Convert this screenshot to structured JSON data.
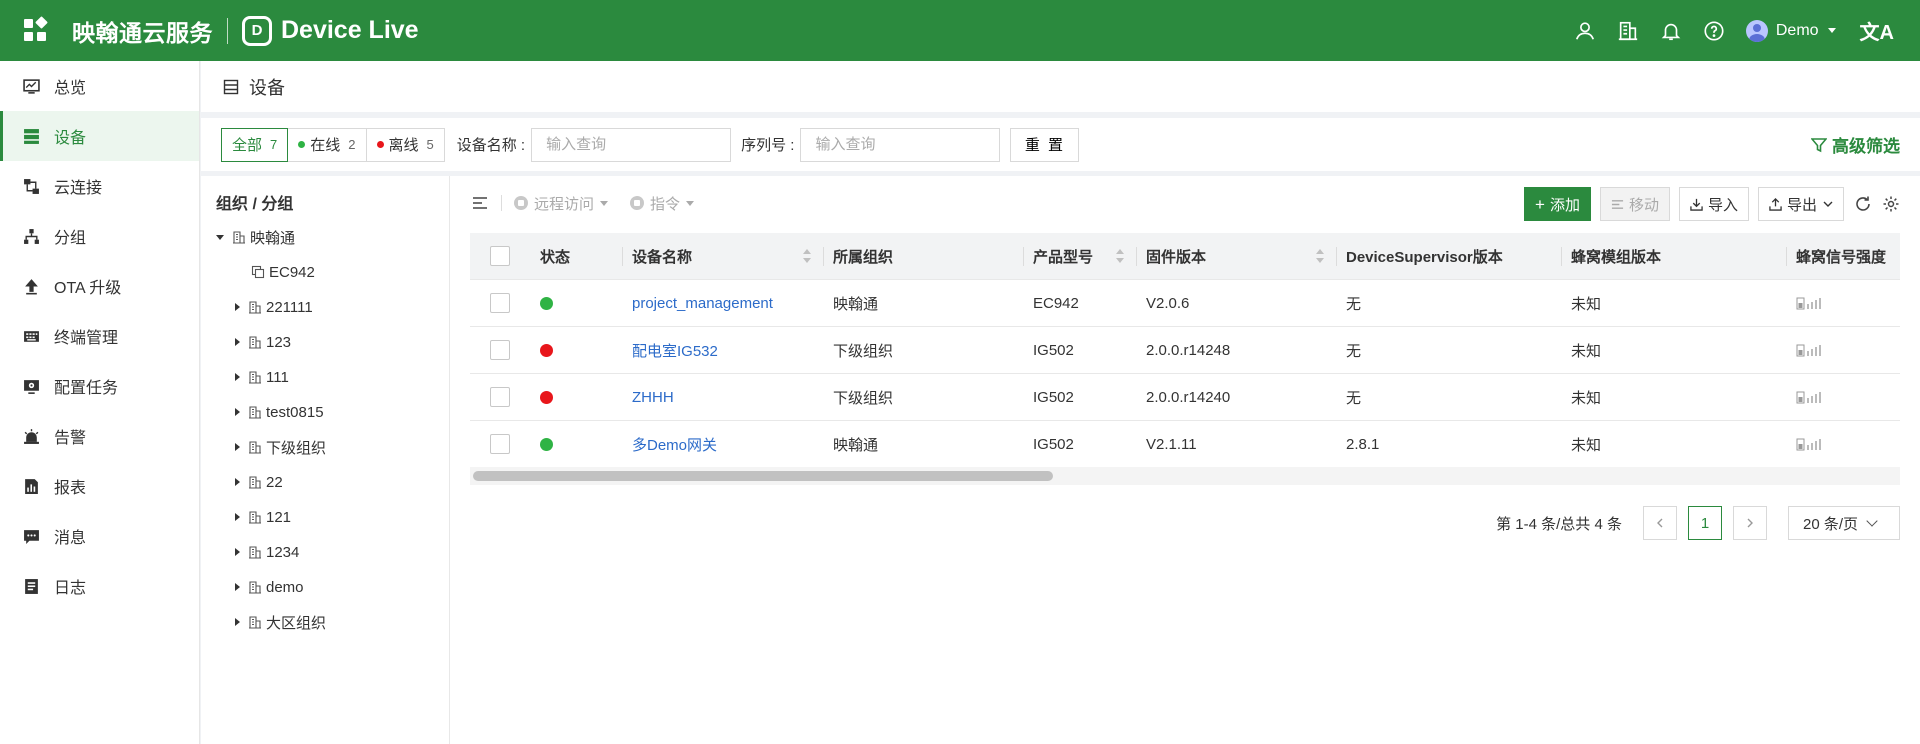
{
  "header": {
    "brand": "映翰通云服务",
    "product_logo": "D",
    "product": "Device Live",
    "user": "Demo",
    "lang_icon": "文A",
    "icons": [
      "user-icon",
      "building-icon",
      "bell-icon",
      "help-icon"
    ]
  },
  "sidebar": {
    "items": [
      {
        "label": "总览",
        "icon": "dashboard-icon"
      },
      {
        "label": "设备",
        "icon": "device-list-icon"
      },
      {
        "label": "云连接",
        "icon": "cloud-connect-icon"
      },
      {
        "label": "分组",
        "icon": "group-icon"
      },
      {
        "label": "OTA 升级",
        "icon": "upload-icon"
      },
      {
        "label": "终端管理",
        "icon": "keyboard-icon"
      },
      {
        "label": "配置任务",
        "icon": "config-task-icon"
      },
      {
        "label": "告警",
        "icon": "alarm-icon"
      },
      {
        "label": "报表",
        "icon": "report-icon"
      },
      {
        "label": "消息",
        "icon": "message-icon"
      },
      {
        "label": "日志",
        "icon": "log-icon"
      }
    ],
    "active_index": 1
  },
  "page": {
    "title": "设备"
  },
  "filter": {
    "status_tabs": [
      {
        "label": "全部",
        "count": "7"
      },
      {
        "label": "在线",
        "count": "2"
      },
      {
        "label": "离线",
        "count": "5"
      }
    ],
    "name_label": "设备名称 :",
    "name_placeholder": "输入查询",
    "sn_label": "序列号 :",
    "sn_placeholder": "输入查询",
    "reset": "重 置",
    "advanced": "高级筛选"
  },
  "tree": {
    "title": "组织 / 分组",
    "root": "映翰通",
    "device_node": "EC942",
    "children": [
      "221111",
      "123",
      "111",
      "test0815",
      "下级组织",
      "22",
      "121",
      "1234",
      "demo",
      "大区组织"
    ]
  },
  "toolbar": {
    "remote_access": "远程访问",
    "command": "指令",
    "add": "添加",
    "move": "移动",
    "import": "导入",
    "export": "导出"
  },
  "table": {
    "columns": {
      "status": "状态",
      "name": "设备名称",
      "org": "所属组织",
      "model": "产品型号",
      "firmware": "固件版本",
      "ds_version": "DeviceSupervisor版本",
      "cell_version": "蜂窝模组版本",
      "signal": "蜂窝信号强度"
    },
    "rows": [
      {
        "status": "online",
        "name": "project_management",
        "org": "映翰通",
        "model": "EC942",
        "firmware": "V2.0.6",
        "ds_version": "无",
        "cell_version": "未知"
      },
      {
        "status": "offline",
        "name": "配电室IG532",
        "org": "下级组织",
        "model": "IG502",
        "firmware": "2.0.0.r14248",
        "ds_version": "无",
        "cell_version": "未知"
      },
      {
        "status": "offline",
        "name": "ZHHH",
        "org": "下级组织",
        "model": "IG502",
        "firmware": "2.0.0.r14240",
        "ds_version": "无",
        "cell_version": "未知"
      },
      {
        "status": "online",
        "name": "多Demo网关",
        "org": "映翰通",
        "model": "IG502",
        "firmware": "V2.1.11",
        "ds_version": "2.8.1",
        "cell_version": "未知"
      }
    ]
  },
  "pagination": {
    "info": "第 1-4 条/总共 4 条",
    "current_page": "1",
    "page_size": "20 条/页"
  },
  "colors": {
    "brand_green": "#2b8a3e",
    "online": "#2fb344",
    "offline": "#e8161b",
    "link": "#2c6bc9"
  }
}
